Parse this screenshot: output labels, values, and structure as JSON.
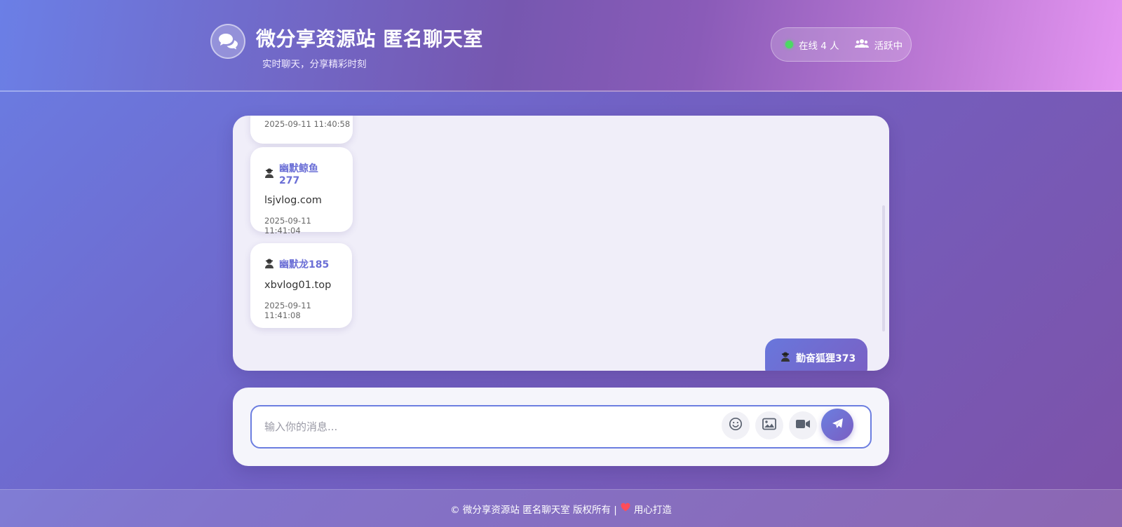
{
  "header": {
    "title": "微分享资源站 匿名聊天室",
    "subtitle": "实时聊天，分享精彩时刻",
    "online_text": "在线 4 人",
    "activity_text": "活跃中",
    "brand_icon": "chat-bubbles-icon",
    "colors": {
      "online_dot": "#4cd964"
    }
  },
  "messages": [
    {
      "time": "2025-09-11 11:40:58"
    },
    {
      "user_icon": "incognito-user-icon",
      "name": "幽默鲸鱼277",
      "text": "lsjvlog.com",
      "time": "2025-09-11 11:41:04"
    },
    {
      "user_icon": "incognito-user-icon",
      "name": "幽默龙185",
      "text": "xbvlog01.top",
      "time": "2025-09-11 11:41:08"
    },
    {
      "user_icon": "incognito-user-icon",
      "name": "勤奋狐狸373",
      "own": true
    }
  ],
  "composer": {
    "placeholder": "输入你的消息...",
    "tools": [
      "emoji-icon",
      "image-icon",
      "video-icon"
    ],
    "send_icon": "send-icon"
  },
  "footer": {
    "copyright": "© 微分享资源站 匿名聊天室 版权所有 |",
    "made_with": "用心打造",
    "heart_color": "#ff4d5a"
  }
}
